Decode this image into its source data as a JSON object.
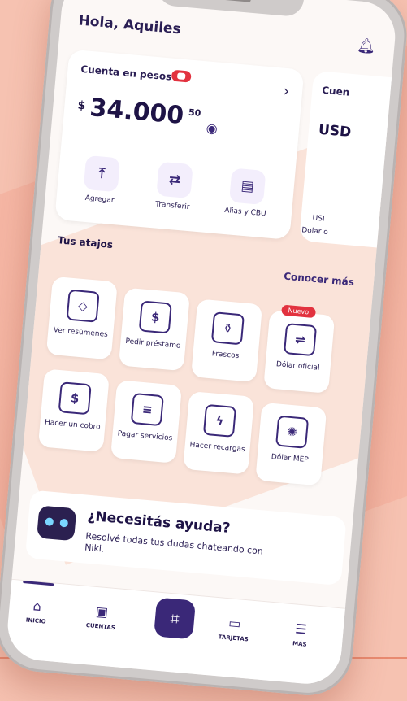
{
  "header": {
    "greeting": "Hola, Aquiles"
  },
  "account_card": {
    "title": "Cuenta en pesos",
    "currency": "$",
    "amount": "34.000",
    "cents": "50",
    "actions": [
      {
        "label": "Agregar",
        "icon": "upload-icon",
        "glyph": "⤒"
      },
      {
        "label": "Transferir",
        "icon": "transfer-icon",
        "glyph": "⇄"
      },
      {
        "label": "Alias y CBU",
        "icon": "id-card-icon",
        "glyph": "▤"
      }
    ]
  },
  "secondary_card": {
    "title": "Cuen",
    "amount": "USD",
    "action1": "USI",
    "action2": "Dolar o"
  },
  "shortcuts": {
    "title": "Tus atajos",
    "more_link": "Conocer más",
    "items": [
      {
        "label": "Ver resúmenes",
        "icon": "receipt-icon",
        "glyph": "◇"
      },
      {
        "label": "Pedir préstamo",
        "icon": "loan-icon",
        "glyph": "$"
      },
      {
        "label": "Frascos",
        "icon": "jar-icon",
        "glyph": "⚱"
      },
      {
        "label": "Dólar oficial",
        "icon": "dollar-exchange-icon",
        "glyph": "⇌",
        "badge": "Nuevo"
      },
      {
        "label": "Hacer un cobro",
        "icon": "charge-icon",
        "glyph": "$"
      },
      {
        "label": "Pagar servicios",
        "icon": "bill-icon",
        "glyph": "≡"
      },
      {
        "label": "Hacer recargas",
        "icon": "recharge-icon",
        "glyph": "ϟ"
      },
      {
        "label": "Dólar MEP",
        "icon": "mep-icon",
        "glyph": "✺"
      }
    ]
  },
  "help": {
    "title": "¿Necesitás ayuda?",
    "subtitle": "Resolvé todas tus dudas chateando con Niki."
  },
  "nav": {
    "items": [
      {
        "label": "INICIO",
        "icon": "home-icon",
        "glyph": "⌂"
      },
      {
        "label": "CUENTAS",
        "icon": "accounts-icon",
        "glyph": "▣"
      },
      {
        "label": "TARJETAS",
        "icon": "card-icon",
        "glyph": "▭"
      },
      {
        "label": "MÁS",
        "icon": "menu-icon",
        "glyph": "☰"
      }
    ],
    "scan_glyph": "⌗"
  },
  "colors": {
    "primary": "#3a2878",
    "accent": "#e2323f",
    "background": "#f6c2b1"
  }
}
